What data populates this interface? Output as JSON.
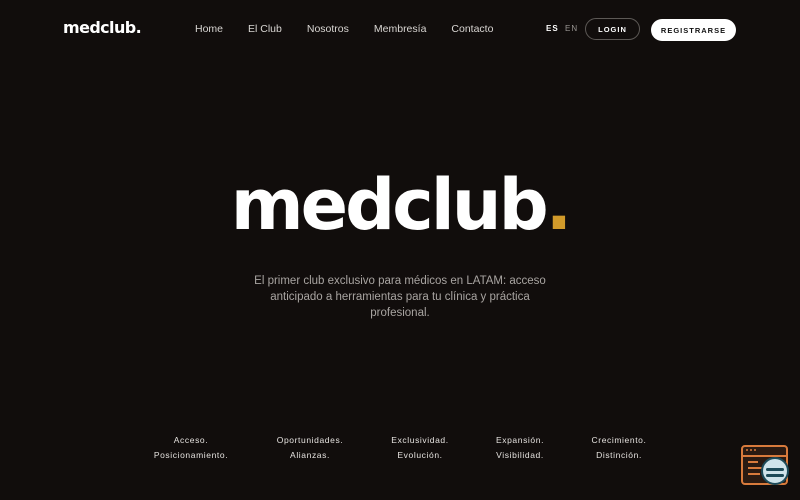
{
  "header": {
    "logo": "medclub.",
    "nav": [
      "Home",
      "El Club",
      "Nosotros",
      "Membresía",
      "Contacto"
    ],
    "lang_es": "ES",
    "lang_en": "EN",
    "login_label": "LOGIN",
    "register_label": "REGISTRARSE"
  },
  "hero": {
    "title": "medclub",
    "title_dot": ".",
    "description": "El primer club exclusivo para médicos en LATAM: acceso anticipado a herramientas para tu clínica y práctica profesional."
  },
  "values": [
    {
      "line1": "Acceso.",
      "line2": "Posicionamiento."
    },
    {
      "line1": "Oportunidades.",
      "line2": "Alianzas."
    },
    {
      "line1": "Exclusividad.",
      "line2": "Evolución."
    },
    {
      "line1": "Expansión.",
      "line2": "Visibilidad."
    },
    {
      "line1": "Crecimiento.",
      "line2": "Distinción."
    }
  ],
  "widget": {
    "icon": "support-chat-icon"
  },
  "colors": {
    "background": "#110d0c",
    "accent": "#d29a2a",
    "widget_accent": "#d87a3c"
  }
}
